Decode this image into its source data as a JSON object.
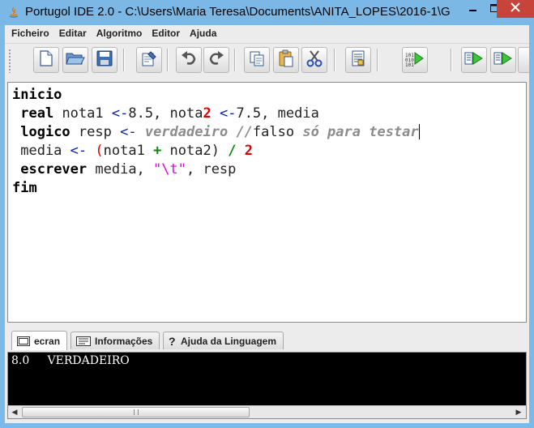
{
  "window": {
    "title": "Portugol IDE 2.0  - C:\\Users\\Maria Teresa\\Documents\\ANITA_LOPES\\2016-1\\G...",
    "minimize_icon": "minimize-icon",
    "maximize_icon": "maximize-icon",
    "close_icon": "close-icon"
  },
  "menu": [
    "Ficheiro",
    "Editar",
    "Algoritmo",
    "Editor",
    "Ajuda"
  ],
  "toolbar": {
    "buttons": [
      "new-file-icon",
      "open-folder-icon",
      "save-icon",
      "edit-document-icon",
      "undo-icon",
      "redo-icon",
      "copy-icon",
      "paste-icon",
      "cut-icon",
      "properties-icon",
      "run-binary-icon",
      "step-run-icon",
      "step-over-icon"
    ]
  },
  "editor": {
    "lines": [
      [
        {
          "t": "inicio",
          "c": "kw"
        }
      ],
      [
        {
          "t": " "
        },
        {
          "t": "real",
          "c": "kw"
        },
        {
          "t": " nota1 "
        },
        {
          "t": "<-",
          "c": "op"
        },
        {
          "t": "8.5, nota"
        },
        {
          "t": "2",
          "c": "num"
        },
        {
          "t": " "
        },
        {
          "t": "<-",
          "c": "op"
        },
        {
          "t": "7.5, media"
        }
      ],
      [
        {
          "t": " "
        },
        {
          "t": "logico",
          "c": "kw"
        },
        {
          "t": " resp "
        },
        {
          "t": "<-",
          "c": "op"
        },
        {
          "t": " "
        },
        {
          "t": "verdadeiro",
          "c": "lit"
        },
        {
          "t": " "
        },
        {
          "t": "//",
          "c": "cmt"
        },
        {
          "t": "falso"
        },
        {
          "t": " só para testar",
          "c": "cmt"
        },
        {
          "t": "",
          "c": "cursor"
        }
      ],
      [
        {
          "t": " media "
        },
        {
          "t": "<-",
          "c": "op"
        },
        {
          "t": " "
        },
        {
          "t": "(",
          "c": "paren"
        },
        {
          "t": "nota1 "
        },
        {
          "t": "+",
          "c": "plus"
        },
        {
          "t": " nota2) "
        },
        {
          "t": "/",
          "c": "slash"
        },
        {
          "t": " "
        },
        {
          "t": "2",
          "c": "num"
        }
      ],
      [
        {
          "t": " "
        },
        {
          "t": "escrever",
          "c": "kw"
        },
        {
          "t": " media, "
        },
        {
          "t": "\"\\t\"",
          "c": "str"
        },
        {
          "t": ", resp"
        }
      ],
      [
        {
          "t": "fim",
          "c": "kw"
        }
      ]
    ]
  },
  "tabs": [
    {
      "label": "ecran",
      "icon": "console-icon",
      "active": true
    },
    {
      "label": "Informações",
      "icon": "info-panel-icon",
      "active": false
    },
    {
      "label": "Ajuda da Linguagem",
      "icon": "question-icon",
      "active": false
    }
  ],
  "console": {
    "output": "8.0     VERDADEIRO"
  },
  "scrollbar": {
    "left_icon": "scroll-left-icon",
    "right_icon": "scroll-right-icon"
  }
}
